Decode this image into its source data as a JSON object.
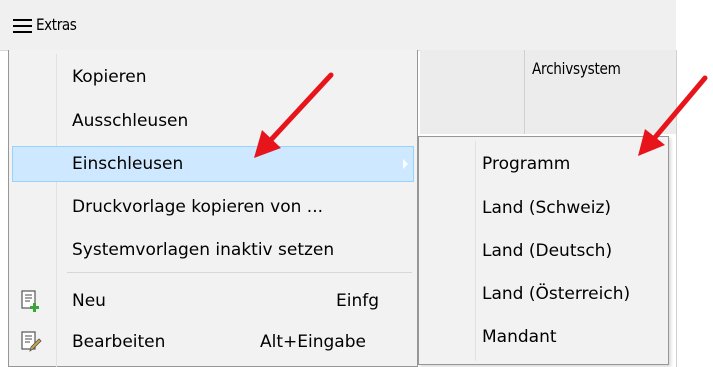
{
  "toolbar": {
    "title": "Extras",
    "icon": "hamburger-icon"
  },
  "grid": {
    "column_header": "Archivsystem"
  },
  "menu": {
    "items": [
      {
        "label": "Kopieren"
      },
      {
        "label": "Ausschleusen"
      },
      {
        "label": "Einschleusen",
        "highlighted": true,
        "has_submenu": true
      },
      {
        "label": "Druckvorlage kopieren von ..."
      },
      {
        "label": "Systemvorlagen inaktiv setzen"
      },
      {
        "label": "Neu",
        "shortcut": "Einfg",
        "icon": "new-record-icon"
      },
      {
        "label": "Bearbeiten",
        "shortcut": "Alt+Eingabe",
        "icon": "edit-record-icon"
      }
    ]
  },
  "submenu": {
    "items": [
      {
        "label": "Programm"
      },
      {
        "label": "Land (Schweiz)"
      },
      {
        "label": "Land (Deutsch)"
      },
      {
        "label": "Land (Österreich)"
      },
      {
        "label": "Mandant"
      }
    ]
  },
  "colors": {
    "highlight_bg": "#cde8ff",
    "highlight_border": "#99d1ff",
    "menu_bg": "#f2f2f2",
    "annotation_arrow": "#e8141b"
  }
}
